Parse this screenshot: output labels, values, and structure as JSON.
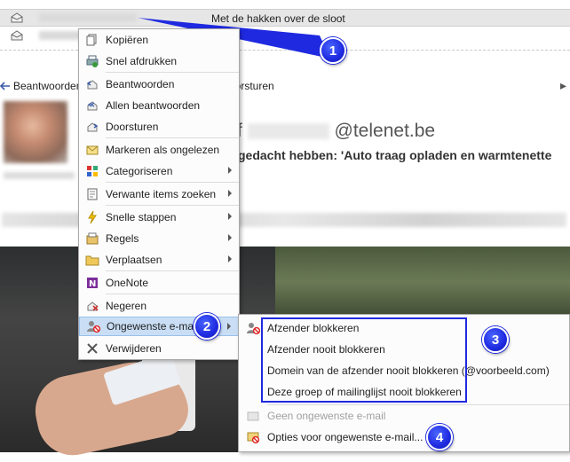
{
  "mail_list": {
    "row1_subject": "Met de hakken over de sloot"
  },
  "reading_pane": {
    "reply_label": "Beantwoorden",
    "forward_label": "oorsturen",
    "sender_initial": "f",
    "sender_email": "@telenet.be",
    "subject_visible": "gedacht hebben: 'Auto traag opladen en warmtenette"
  },
  "context_menu": {
    "items": [
      {
        "label": "Kopiëren",
        "icon": "copy-icon",
        "submenu": false
      },
      {
        "label": "Snel afdrukken",
        "icon": "quick-print-icon",
        "submenu": false
      },
      {
        "label": "Beantwoorden",
        "icon": "reply-icon",
        "submenu": false
      },
      {
        "label": "Allen beantwoorden",
        "icon": "reply-all-icon",
        "submenu": false
      },
      {
        "label": "Doorsturen",
        "icon": "forward-icon",
        "submenu": false
      },
      {
        "label": "Markeren als ongelezen",
        "icon": "mark-unread-icon",
        "submenu": false
      },
      {
        "label": "Categoriseren",
        "icon": "categorize-icon",
        "submenu": true
      },
      {
        "label": "Verwante items zoeken",
        "icon": "related-items-icon",
        "submenu": true
      },
      {
        "label": "Snelle stappen",
        "icon": "quick-steps-icon",
        "submenu": true
      },
      {
        "label": "Regels",
        "icon": "rules-icon",
        "submenu": true
      },
      {
        "label": "Verplaatsen",
        "icon": "move-folder-icon",
        "submenu": true
      },
      {
        "label": "OneNote",
        "icon": "onenote-icon",
        "submenu": false
      },
      {
        "label": "Negeren",
        "icon": "ignore-icon",
        "submenu": false
      },
      {
        "label": "Ongewenste e-mail",
        "icon": "junk-mail-icon",
        "submenu": true
      },
      {
        "label": "Verwijderen",
        "icon": "delete-icon",
        "submenu": false
      }
    ]
  },
  "junk_submenu": {
    "items": [
      {
        "label": "Afzender blokkeren",
        "icon": "block-sender-icon",
        "disabled": false
      },
      {
        "label": "Afzender nooit blokkeren",
        "icon": "",
        "disabled": false
      },
      {
        "label": "Domein van de afzender nooit blokkeren (@voorbeeld.com)",
        "icon": "",
        "disabled": false
      },
      {
        "label": "Deze groep of mailinglijst nooit blokkeren",
        "icon": "",
        "disabled": false
      },
      {
        "label": "Geen ongewenste e-mail",
        "icon": "not-junk-icon",
        "disabled": true
      },
      {
        "label": "Opties voor ongewenste e-mail...",
        "icon": "junk-options-icon",
        "disabled": false
      }
    ]
  },
  "callouts": [
    "1",
    "2",
    "3",
    "4"
  ],
  "colors": {
    "callout_blue": "#1f2ae0",
    "menu_highlight": "#c9def5"
  }
}
